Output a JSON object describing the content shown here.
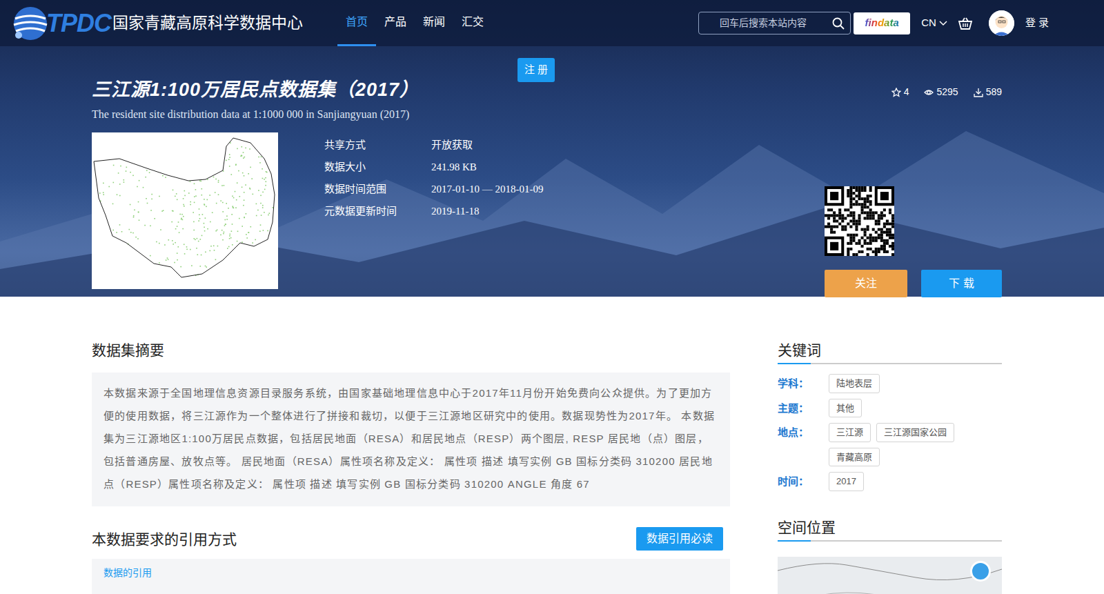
{
  "header": {
    "logo_abbr": "TPDC",
    "logo_name": "国家青藏高原科学数据中心",
    "nav": [
      {
        "label": "首页",
        "selected": true
      },
      {
        "label": "产品",
        "selected": false
      },
      {
        "label": "新闻",
        "selected": false
      },
      {
        "label": "汇交",
        "selected": false
      }
    ],
    "search": {
      "placeholder": "回车后搜索本站内容"
    },
    "findata": "findata",
    "lang": "CN",
    "login": "登 录"
  },
  "register": "注 册",
  "dataset": {
    "title": "三江源1:100万居民点数据集（2017）",
    "subtitle": "The resident site distribution data at 1:1000 000 in Sanjiangyuan (2017)",
    "meta": [
      {
        "label": "共享方式",
        "value": "开放获取"
      },
      {
        "label": "数据大小",
        "value": "241.98 KB"
      },
      {
        "label": "数据时间范围",
        "value": "2017-01-10 — 2018-01-09"
      },
      {
        "label": "元数据更新时间",
        "value": "2019-11-18"
      }
    ],
    "stats": [
      {
        "kind": "star",
        "value": "4"
      },
      {
        "kind": "view",
        "value": "5295"
      },
      {
        "kind": "download",
        "value": "589"
      }
    ],
    "follow": "关注",
    "download": "下 载"
  },
  "abstract": {
    "heading": "数据集摘要",
    "text": "本数据来源于全国地理信息资源目录服务系统，由国家基础地理信息中心于2017年11月份开始免费向公众提供。为了更加方便的使用数据，将三江源作为一个整体进行了拼接和裁切，以便于三江源地区研究中的使用。数据现势性为2017年。 本数据集为三江源地区1:100万居民点数据，包括居民地面（RESA）和居民地点（RESP）两个图层, RESP 居民地（点）图层，包括普通房屋、放牧点等。 居民地面（RESA）属性项名称及定义： 属性项 描述 填写实例 GB 国标分类码 310200 居民地点（RESP）属性项名称及定义： 属性项 描述 填写实例 GB 国标分类码 310200 ANGLE 角度 67"
  },
  "citation": {
    "heading": "本数据要求的引用方式",
    "button": "数据引用必读",
    "sub": "数据的引用"
  },
  "keywords": {
    "heading": "关键词",
    "groups": [
      {
        "label": "学科：",
        "tags": [
          "陆地表层"
        ]
      },
      {
        "label": "主题：",
        "tags": [
          "其他"
        ]
      },
      {
        "label": "地点：",
        "tags": [
          "三江源",
          "三江源国家公园",
          "青藏高原"
        ]
      },
      {
        "label": "时间：",
        "tags": [
          "2017"
        ]
      }
    ]
  },
  "spatial": {
    "heading": "空间位置"
  }
}
